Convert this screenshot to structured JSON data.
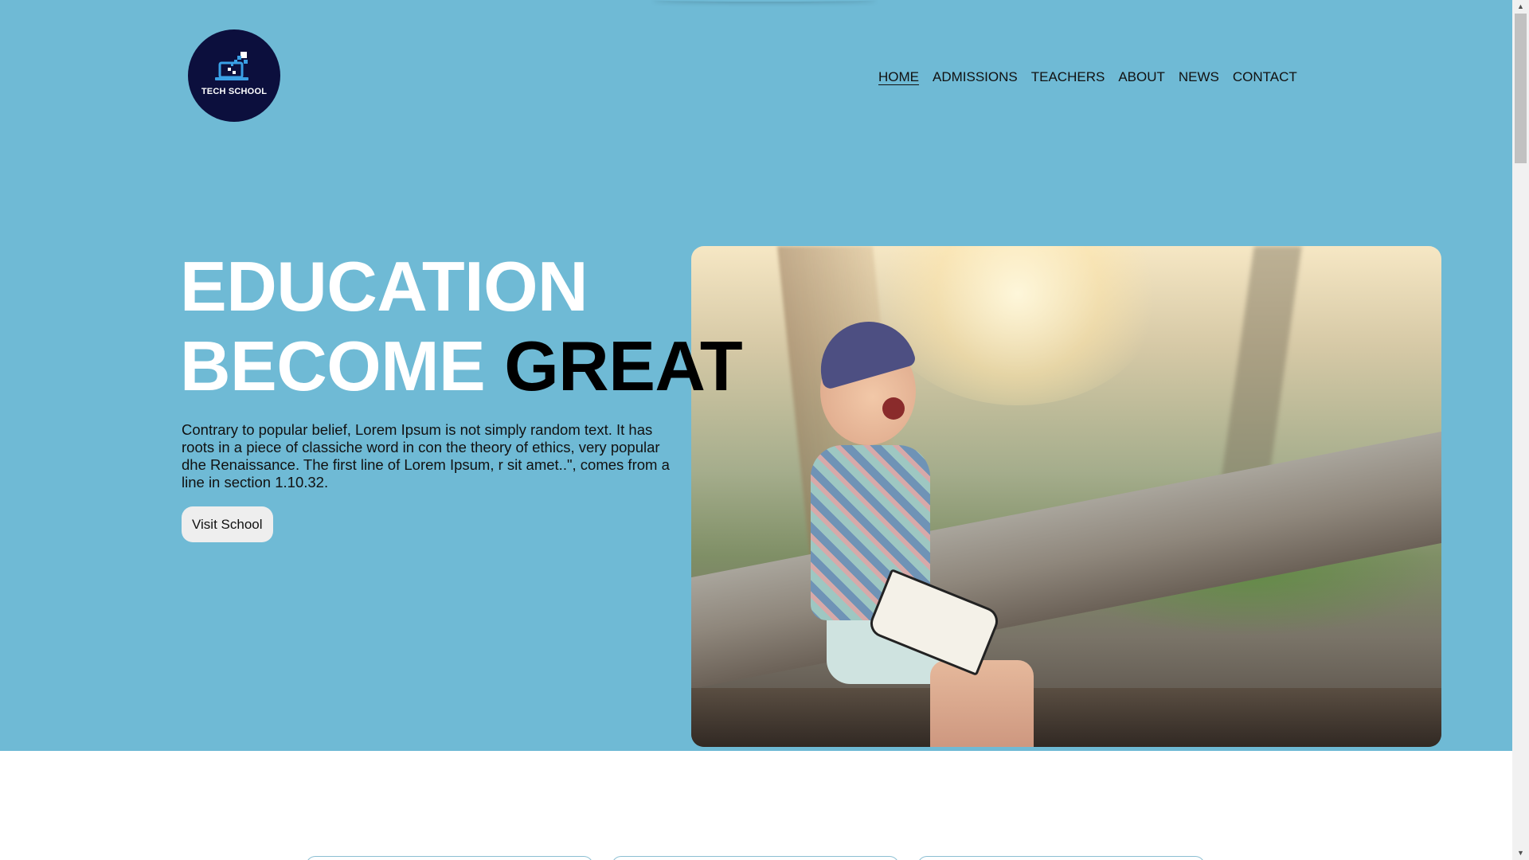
{
  "logo": {
    "text": "TECH SCHOOL",
    "icon": "laptop-pixels-icon",
    "background": "#0c0f3d"
  },
  "nav": {
    "items": [
      {
        "label": "HOME",
        "active": true
      },
      {
        "label": "ADMISSIONS",
        "active": false
      },
      {
        "label": "TEACHERS",
        "active": false
      },
      {
        "label": "ABOUT",
        "active": false
      },
      {
        "label": "NEWS",
        "active": false
      },
      {
        "label": "CONTACT",
        "active": false
      }
    ]
  },
  "hero": {
    "headline_line1": "EDUCATION",
    "headline_line2_light": "BECOME",
    "headline_line2_dark": "GREAT",
    "paragraph": "Contrary to popular belief, Lorem Ipsum is not simply random text. It has roots in a piece of classiche word in con the theory of ethics, very popular dhe Renaissance. The first line of Lorem Ipsum, r sit amet..\", comes from a line in section 1.10.32.",
    "button_label": "Visit School",
    "image": "laughing-boy-reading-book-on-bench-photo"
  },
  "colors": {
    "hero_background": "#6fbad5",
    "headline_light": "#ffffff",
    "headline_dark": "#000000",
    "button_background": "#eeeeee",
    "card_border": "#8bbfd3"
  },
  "scrollbar": {
    "up_arrow": "▲",
    "down_arrow": "▼"
  }
}
